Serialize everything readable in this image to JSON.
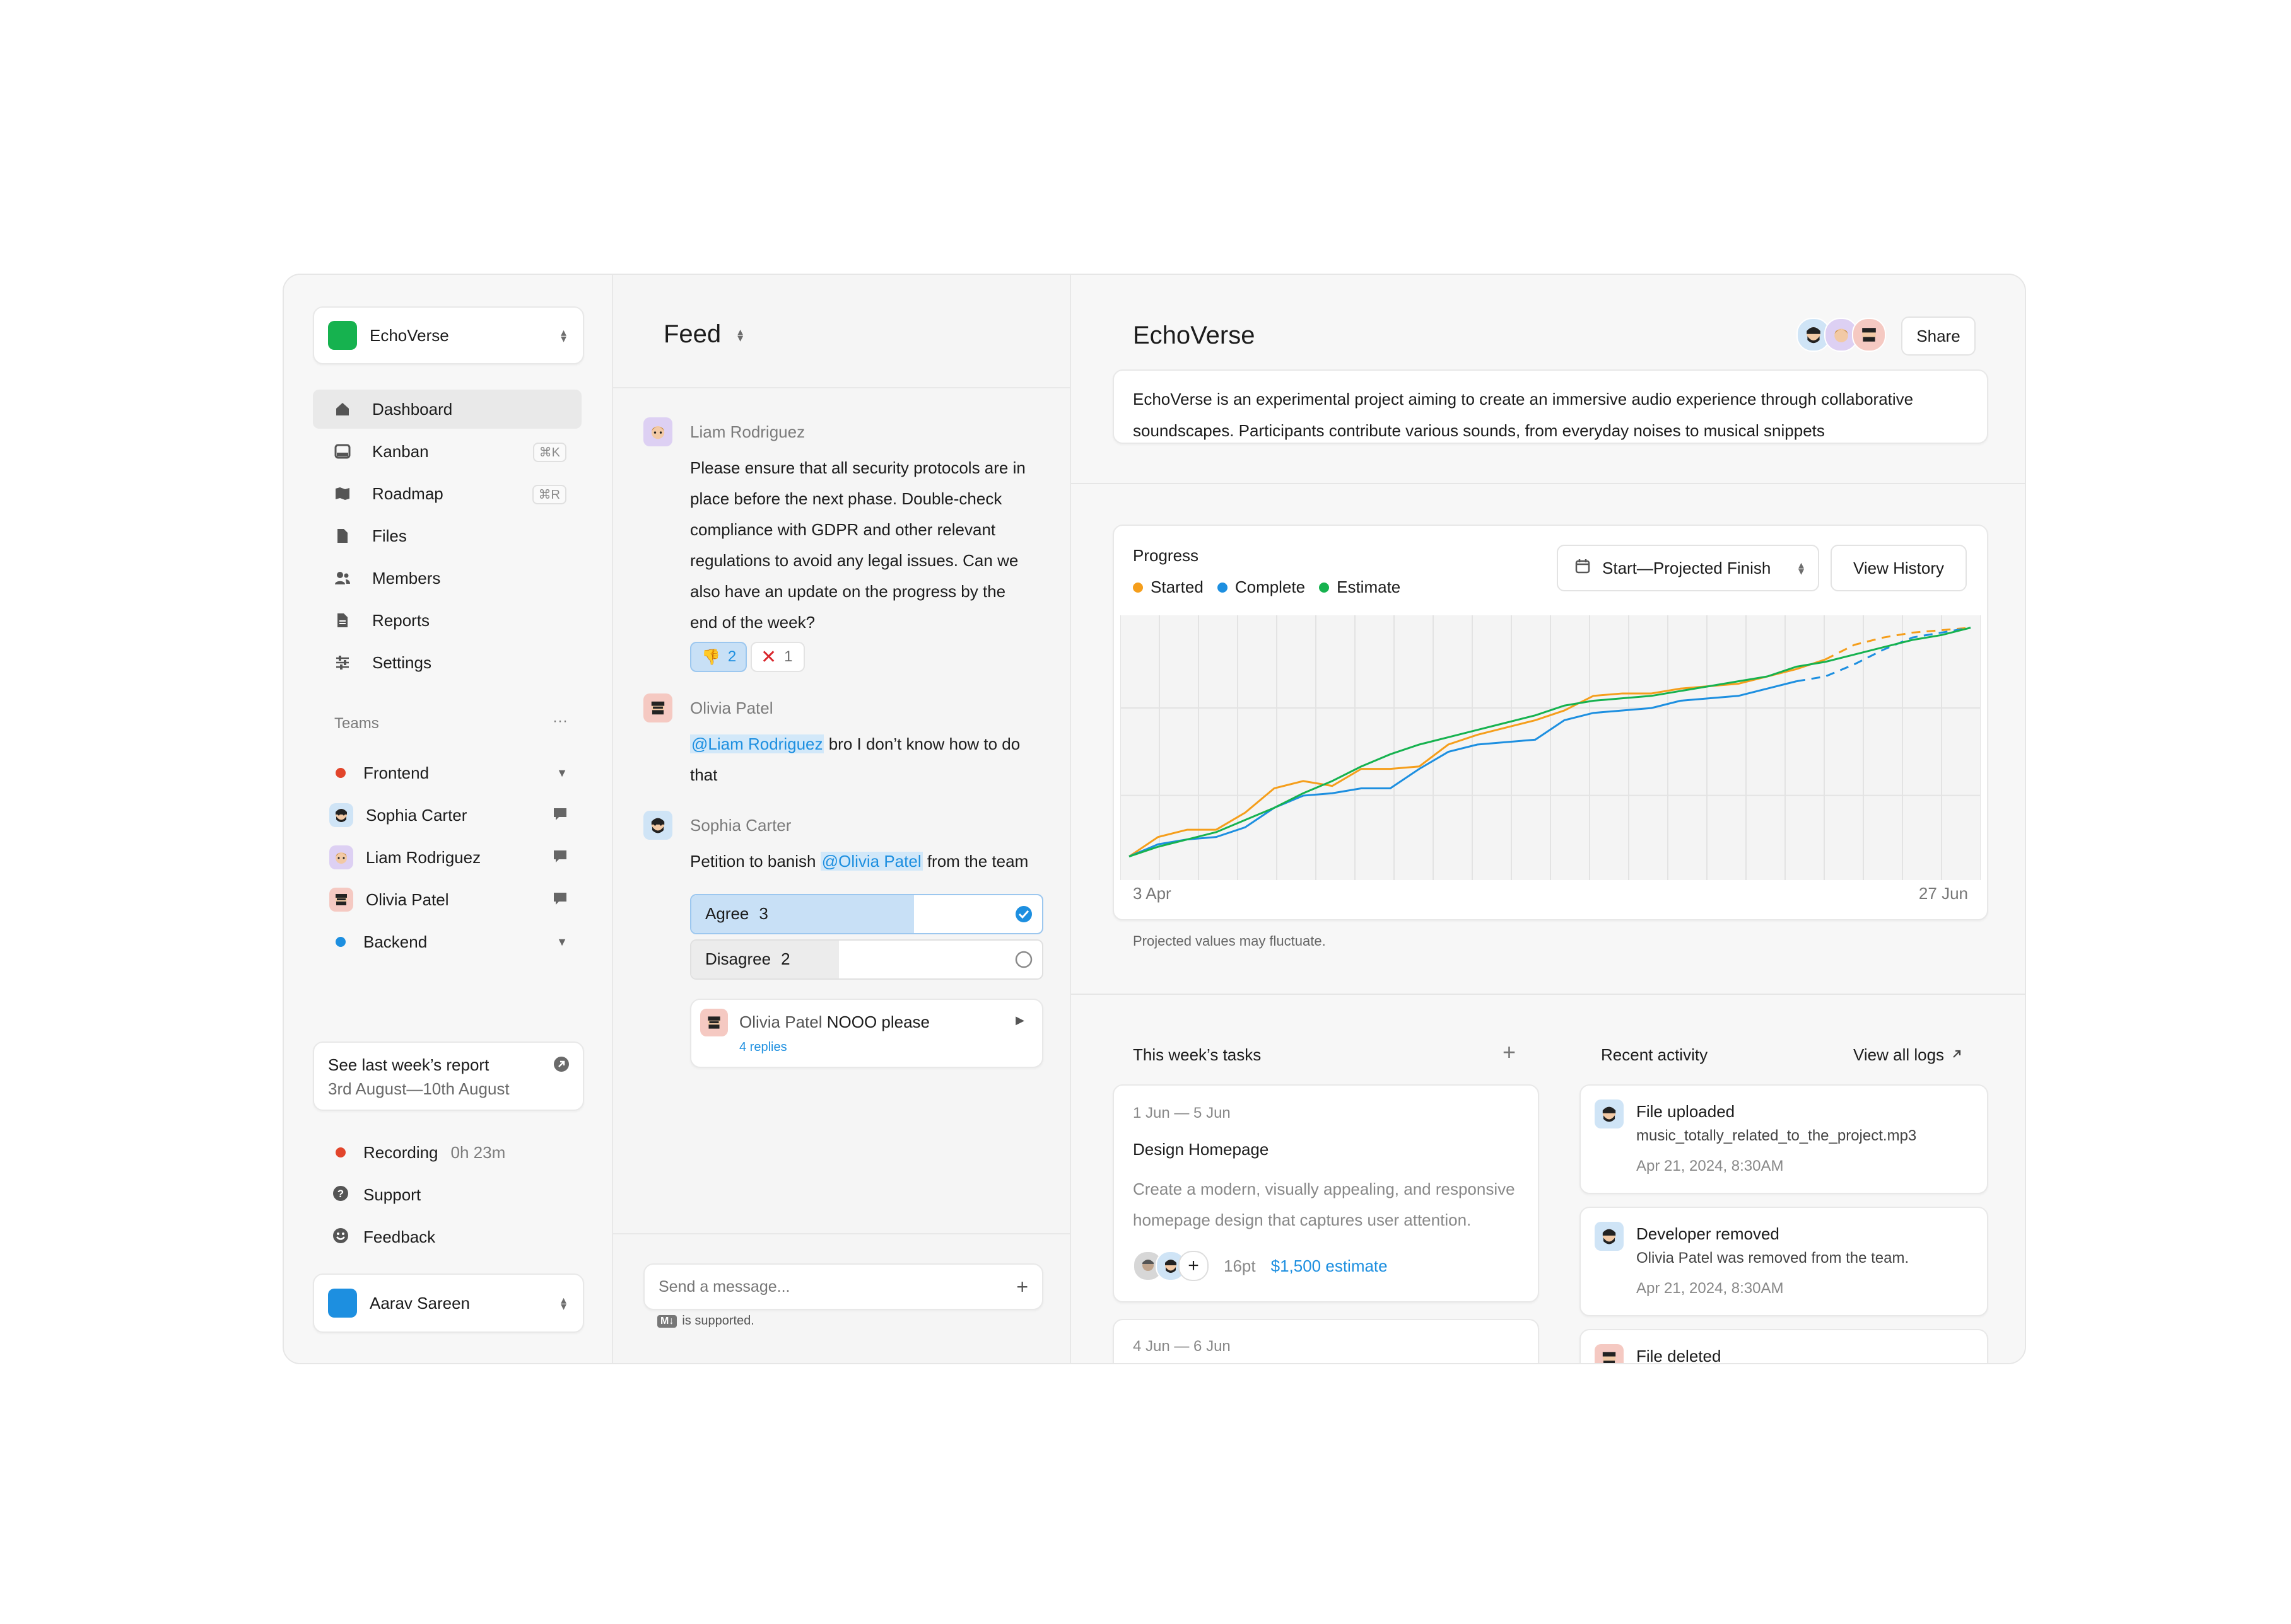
{
  "colors": {
    "brand_green": "#16b24f",
    "accent_blue": "#1d8fe0",
    "started": "#f59e1b",
    "complete": "#1d8fe0",
    "estimate": "#16b24f",
    "recording_red": "#e2452b"
  },
  "workspace": {
    "name": "EchoVerse"
  },
  "nav": {
    "items": [
      {
        "label": "Dashboard",
        "icon": "home-icon",
        "active": true
      },
      {
        "label": "Kanban",
        "icon": "kanban-icon",
        "shortcut": "⌘K"
      },
      {
        "label": "Roadmap",
        "icon": "map-icon",
        "shortcut": "⌘R"
      },
      {
        "label": "Files",
        "icon": "file-icon"
      },
      {
        "label": "Members",
        "icon": "members-icon"
      },
      {
        "label": "Reports",
        "icon": "report-icon"
      },
      {
        "label": "Settings",
        "icon": "settings-icon"
      }
    ]
  },
  "teams": {
    "heading": "Teams",
    "more": "···",
    "frontend": {
      "label": "Frontend"
    },
    "members": [
      {
        "name": "Sophia Carter"
      },
      {
        "name": "Liam Rodriguez"
      },
      {
        "name": "Olivia Patel"
      }
    ],
    "backend": {
      "label": "Backend"
    }
  },
  "report_card": {
    "title": "See last week’s report",
    "dates": "3rd August—10th August"
  },
  "footer_nav": {
    "recording": {
      "label": "Recording",
      "time": "0h 23m"
    },
    "support": {
      "label": "Support"
    },
    "feedback": {
      "label": "Feedback"
    }
  },
  "user": {
    "name": "Aarav Sareen"
  },
  "feed": {
    "title": "Feed",
    "posts": {
      "liam": {
        "author": "Liam Rodriguez",
        "lines": [
          "Please ensure that all security protocols are in",
          "place before the next phase. Double-check",
          "compliance with GDPR and other relevant",
          "regulations to avoid any legal issues. Can we",
          "also have an update on the progress by the",
          "end of the week?"
        ],
        "reaction_thumbs": "2",
        "reaction_x": "1"
      },
      "olivia": {
        "author": "Olivia Patel",
        "mention": "@Liam Rodriguez",
        "text_after": " bro I don’t know how to do",
        "line2": "that"
      },
      "sophia": {
        "author": "Sophia Carter",
        "text_before": "Petition to banish ",
        "mention": "@Olivia Patel",
        "text_after": " from the team",
        "poll": {
          "agree_label": "Agree",
          "agree_count": "3",
          "agree_fraction": 0.635,
          "disagree_label": "Disagree",
          "disagree_count": "2",
          "disagree_fraction": 0.42
        },
        "thread": {
          "author": "Olivia Patel",
          "text": "NOOO please",
          "replies": "4 replies"
        }
      }
    },
    "composer": {
      "placeholder": "Send a message...",
      "md_badge": "M↓",
      "md_note": "is supported."
    }
  },
  "project": {
    "title": "EchoVerse",
    "share": "Share",
    "description_line1": "EchoVerse is an experimental project aiming to create an immersive audio experience through collaborative",
    "description_line2": "soundscapes. Participants contribute various sounds, from everyday noises to musical snippets"
  },
  "progress": {
    "title": "Progress",
    "legend": [
      "Started",
      "Complete",
      "Estimate"
    ],
    "range_select": "Start—Projected Finish",
    "history_button": "View History",
    "note": "Projected values may fluctuate."
  },
  "chart_data": {
    "type": "line",
    "title": "Progress",
    "xlabel": "",
    "ylabel": "",
    "x_start_label": "3 Apr",
    "x_end_label": "27 Jun",
    "ylim": [
      0,
      100
    ],
    "grid": true,
    "legend_position": "top-left",
    "x": [
      0,
      1,
      2,
      3,
      4,
      5,
      6,
      7,
      8,
      9,
      10,
      11,
      12,
      13,
      14,
      15,
      16,
      17,
      18,
      19,
      20,
      21,
      22,
      23,
      24,
      25,
      26,
      27,
      28,
      29
    ],
    "series": [
      {
        "name": "Started",
        "values": [
          4,
          12,
          15,
          15,
          22,
          32,
          35,
          33,
          40,
          40,
          41,
          50,
          54,
          57,
          60,
          64,
          70,
          71,
          71,
          73,
          74,
          75,
          78,
          81,
          85,
          91,
          94,
          96,
          97,
          98
        ],
        "projected_from": 24
      },
      {
        "name": "Complete",
        "values": [
          4,
          9,
          11,
          12,
          16,
          24,
          29,
          30,
          32,
          32,
          40,
          47,
          50,
          51,
          52,
          60,
          63,
          64,
          65,
          68,
          69,
          70,
          73,
          76,
          78,
          83,
          89,
          94,
          96,
          98
        ],
        "projected_from": 23
      },
      {
        "name": "Estimate",
        "values": [
          4,
          8,
          11,
          14,
          19,
          24,
          30,
          35,
          41,
          46,
          50,
          53,
          56,
          59,
          62,
          66,
          68,
          69,
          70,
          72,
          74,
          76,
          78,
          82,
          84,
          87,
          90,
          93,
          95,
          98
        ]
      }
    ]
  },
  "tasks": {
    "title": "This week’s tasks",
    "add": "+",
    "items": [
      {
        "dates": "1 Jun — 5 Jun",
        "name": "Design Homepage",
        "desc_line1": "Create a modern, visually appealing, and responsive",
        "desc_line2": "homepage design that captures user attention.",
        "points": "16pt",
        "estimate": "$1,500 estimate"
      },
      {
        "dates": "4 Jun — 6 Jun"
      }
    ]
  },
  "activity": {
    "title": "Recent activity",
    "view_all": "View all logs",
    "items": [
      {
        "title": "File uploaded",
        "detail": "music_totally_related_to_the_project.mp3",
        "time": "Apr 21, 2024, 8:30AM"
      },
      {
        "title": "Developer removed",
        "detail": "Olivia Patel was removed from the team.",
        "time": "Apr 21, 2024, 8:30AM"
      },
      {
        "title": "File deleted"
      }
    ]
  }
}
